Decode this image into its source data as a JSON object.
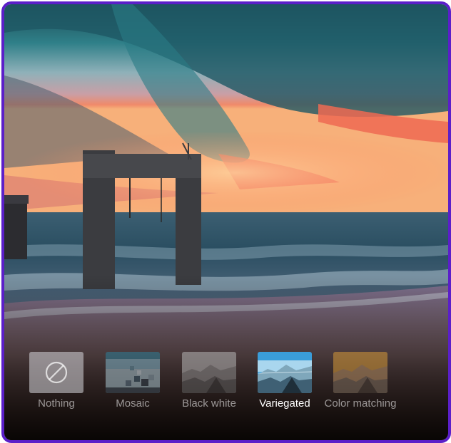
{
  "filters": [
    {
      "label": "Nothing",
      "icon": "prohibited-icon",
      "active": false
    },
    {
      "label": "Mosaic",
      "icon": "mosaic-thumbnail",
      "active": false
    },
    {
      "label": "Black white",
      "icon": "black-white-thumbnail",
      "active": false
    },
    {
      "label": "Variegated",
      "icon": "variegated-thumbnail",
      "active": true
    },
    {
      "label": "Color matching",
      "icon": "color-matching-thumbnail",
      "active": false
    }
  ],
  "colors": {
    "frame_border": "#5b1fc9",
    "label_active": "#ffffff",
    "label_inactive": "#b9b9bf"
  }
}
